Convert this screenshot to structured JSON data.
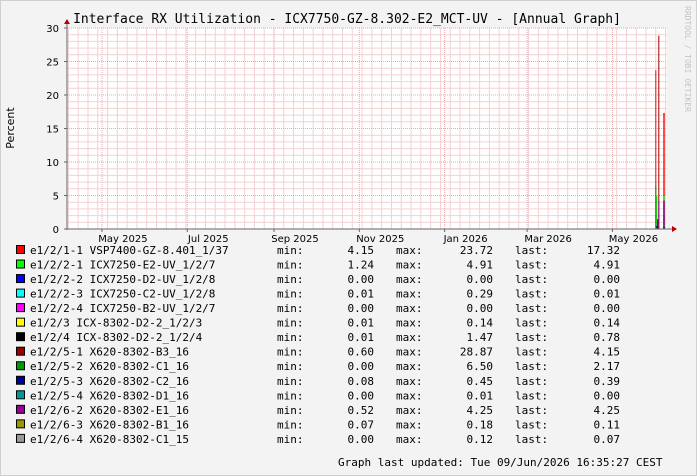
{
  "chart_data": {
    "type": "line",
    "title": "Interface RX Utilization - ICX7750-GZ-8.302-E2_MCT-UV - [Annual Graph]",
    "ylabel": "Percent",
    "watermark": "RRDTOOL / TOBI OETIKER",
    "ylim": [
      0,
      30
    ],
    "yticks": [
      "0",
      "5",
      "10",
      "15",
      "20",
      "25",
      "30"
    ],
    "x_range": [
      "2025-04-06",
      "2026-06-09"
    ],
    "xticks": [
      {
        "label": "May 2025",
        "date": "2025-05-01"
      },
      {
        "label": "Jul 2025",
        "date": "2025-07-01"
      },
      {
        "label": "Sep 2025",
        "date": "2025-09-01"
      },
      {
        "label": "Nov 2025",
        "date": "2025-11-01"
      },
      {
        "label": "Jan 2026",
        "date": "2026-01-01"
      },
      {
        "label": "Mar 2026",
        "date": "2026-03-01"
      },
      {
        "label": "May 2026",
        "date": "2026-05-01"
      }
    ],
    "data_start": "2026-06-01",
    "grid": true,
    "legend_placement": "bottom",
    "stat_labels": {
      "min": "min:",
      "max": "max:",
      "last": "last:"
    },
    "footer": "Graph last updated: Tue 09/Jun/2026 16:35:27 CEST",
    "series": [
      {
        "name": "e1/2/1-1 VSP7400-GZ-8.401_1/37",
        "color": "#ff0000",
        "min": "4.15",
        "max": "23.72",
        "last": "17.32"
      },
      {
        "name": "e1/2/2-1 ICX7250-E2-UV_1/2/7",
        "color": "#00ff00",
        "min": "1.24",
        "max": "4.91",
        "last": "4.91"
      },
      {
        "name": "e1/2/2-2 ICX7250-D2-UV_1/2/8",
        "color": "#0000ff",
        "min": "0.00",
        "max": "0.00",
        "last": "0.00"
      },
      {
        "name": "e1/2/2-3 ICX7250-C2-UV_1/2/8",
        "color": "#00ffff",
        "min": "0.01",
        "max": "0.29",
        "last": "0.01"
      },
      {
        "name": "e1/2/2-4 ICX7250-B2-UV_1/2/7",
        "color": "#ff00ff",
        "min": "0.00",
        "max": "0.00",
        "last": "0.00"
      },
      {
        "name": "e1/2/3 ICX-8302-D2-2_1/2/3",
        "color": "#ffff00",
        "min": "0.01",
        "max": "0.14",
        "last": "0.14"
      },
      {
        "name": "e1/2/4 ICX-8302-D2-2_1/2/4",
        "color": "#000000",
        "min": "0.01",
        "max": "1.47",
        "last": "0.78"
      },
      {
        "name": "e1/2/5-1 X620-8302-B3_16",
        "color": "#990000",
        "min": "0.60",
        "max": "28.87",
        "last": "4.15"
      },
      {
        "name": "e1/2/5-2 X620-8302-C1_16",
        "color": "#009900",
        "min": "0.00",
        "max": "6.50",
        "last": "2.17"
      },
      {
        "name": "e1/2/5-3 X620-8302-C2_16",
        "color": "#000099",
        "min": "0.08",
        "max": "0.45",
        "last": "0.39"
      },
      {
        "name": "e1/2/5-4 X620-8302-D1_16",
        "color": "#009999",
        "min": "0.00",
        "max": "0.01",
        "last": "0.00"
      },
      {
        "name": "e1/2/6-2 X620-8302-E1_16",
        "color": "#990099",
        "min": "0.52",
        "max": "4.25",
        "last": "4.25"
      },
      {
        "name": "e1/2/6-3 X620-8302-B1_16",
        "color": "#999900",
        "min": "0.07",
        "max": "0.18",
        "last": "0.11"
      },
      {
        "name": "e1/2/6-4 X620-8302-C1_15",
        "color": "#999999",
        "min": "0.00",
        "max": "0.12",
        "last": "0.07"
      }
    ]
  }
}
